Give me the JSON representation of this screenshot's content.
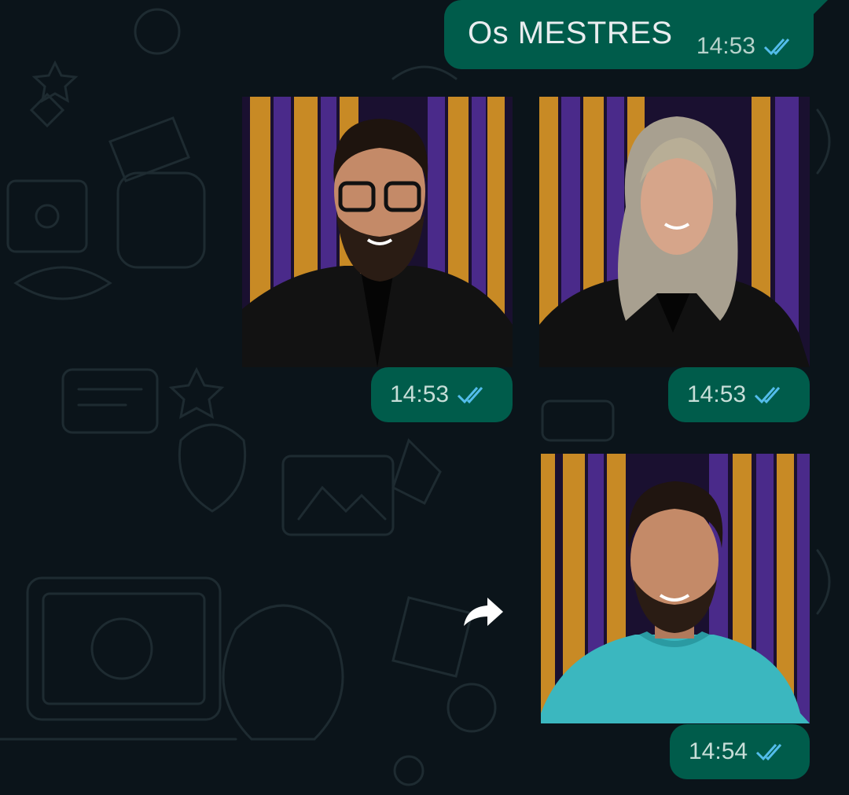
{
  "chat": {
    "messages": [
      {
        "type": "text",
        "text": "Os MESTRES",
        "time": "14:53",
        "status": "read"
      },
      {
        "type": "image",
        "subject": "man-with-glasses",
        "time": "14:53",
        "status": "read"
      },
      {
        "type": "image",
        "subject": "woman-blonde",
        "time": "14:53",
        "status": "read"
      },
      {
        "type": "image",
        "subject": "man-teal-shirt",
        "time": "14:54",
        "status": "read"
      }
    ]
  },
  "icons": {
    "read_ticks": "double-check-icon",
    "forward": "forward-arrow-icon"
  },
  "colors": {
    "background": "#0b141a",
    "outgoing_bubble": "#005c4b",
    "read_ticks": "#53bdeb",
    "wallpaper_doodles": "#1d2a30"
  }
}
